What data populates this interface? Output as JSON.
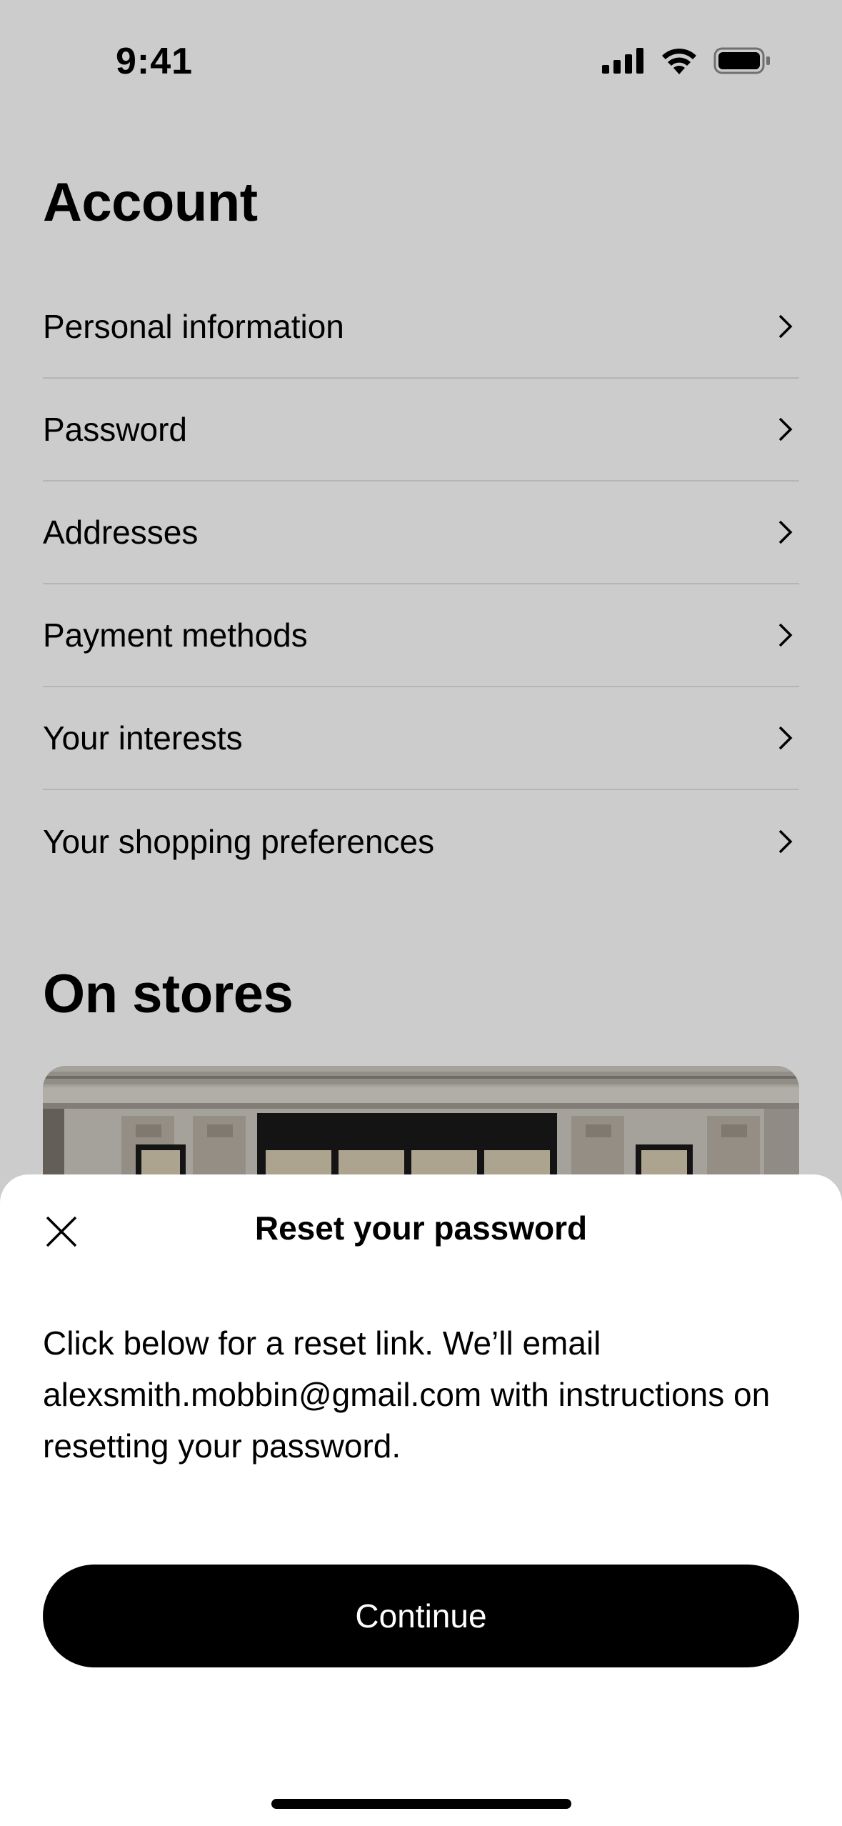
{
  "status_bar": {
    "time": "9:41"
  },
  "account": {
    "title": "Account",
    "items": [
      {
        "label": "Personal information"
      },
      {
        "label": "Password"
      },
      {
        "label": "Addresses"
      },
      {
        "label": "Payment methods"
      },
      {
        "label": "Your interests"
      },
      {
        "label": "Your shopping preferences"
      }
    ]
  },
  "stores": {
    "title": "On stores"
  },
  "sheet": {
    "title": "Reset your password",
    "body": "Click below for a reset link. We’ll email alexsmith.mobbin@gmail.com with instructions on resetting your password.",
    "continue_label": "Continue"
  },
  "icons": {
    "signal": "cellular-signal-icon",
    "wifi": "wifi-icon",
    "battery": "battery-icon",
    "chevron": "chevron-right-icon",
    "close": "close-icon"
  }
}
